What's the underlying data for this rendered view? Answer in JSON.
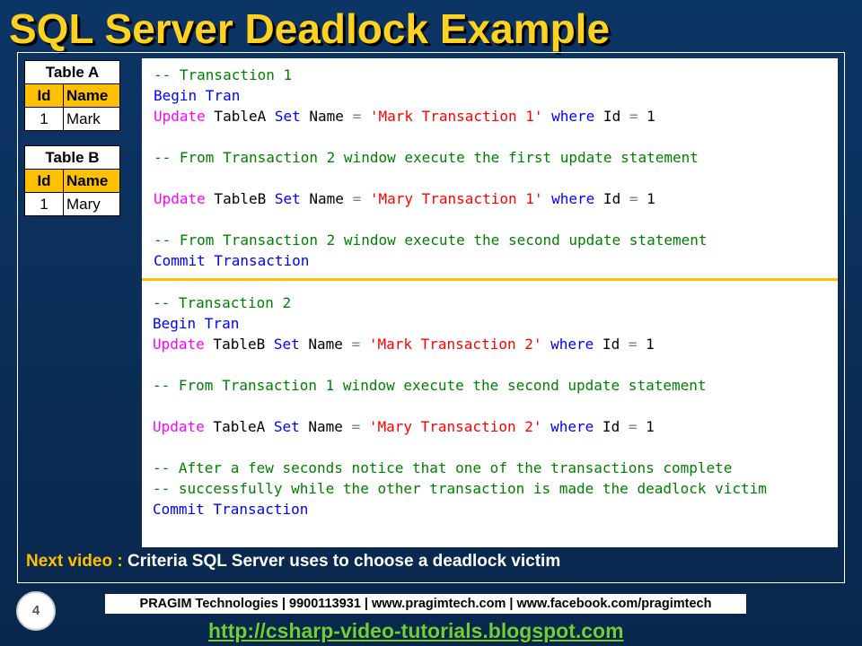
{
  "slide": {
    "title": "SQL Server Deadlock Example",
    "page_number": "4",
    "company_line": "PRAGIM Technologies | 9900113931 | www.pragimtech.com | www.facebook.com/pragimtech",
    "url": "http://csharp-video-tutorials.blogspot.com",
    "next_video_label": "Next video : ",
    "next_video_text": "Criteria SQL Server uses to choose a deadlock victim"
  },
  "tables": [
    {
      "caption": "Table A",
      "headers": [
        "Id",
        "Name"
      ],
      "rows": [
        [
          "1",
          "Mark"
        ]
      ]
    },
    {
      "caption": "Table B",
      "headers": [
        "Id",
        "Name"
      ],
      "rows": [
        [
          "1",
          "Mary"
        ]
      ]
    }
  ],
  "code": {
    "transaction1": {
      "comment_title": "-- Transaction 1",
      "begin": "Begin Tran",
      "update1": {
        "kw_update": "Update",
        "table": " TableA ",
        "kw_set": "Set",
        "col": " Name ",
        "eq": "=",
        "value": " 'Mark Transaction 1' ",
        "kw_where": "where",
        "cond": " Id ",
        "eq2": "=",
        "num": " 1"
      },
      "comment_step": "-- From Transaction 2 window execute the first update statement",
      "update2": {
        "kw_update": "Update",
        "table": " TableB ",
        "kw_set": "Set",
        "col": " Name ",
        "eq": "=",
        "value": " 'Mary Transaction 1' ",
        "kw_where": "where",
        "cond": " Id ",
        "eq2": "=",
        "num": " 1"
      },
      "comment_step2": "-- From Transaction 2 window execute the second update statement",
      "commit": "Commit Transaction"
    },
    "transaction2": {
      "comment_title": "-- Transaction 2",
      "begin": "Begin Tran",
      "update1": {
        "kw_update": "Update",
        "table": " TableB ",
        "kw_set": "Set",
        "col": " Name ",
        "eq": "=",
        "value": " 'Mark Transaction 2' ",
        "kw_where": "where",
        "cond": " Id ",
        "eq2": "=",
        "num": " 1"
      },
      "comment_step": "-- From Transaction 1 window execute the second update statement",
      "update2": {
        "kw_update": "Update",
        "table": " TableA ",
        "kw_set": "Set",
        "col": " Name ",
        "eq": "=",
        "value": " 'Mary Transaction 2' ",
        "kw_where": "where",
        "cond": " Id ",
        "eq2": "=",
        "num": " 1"
      },
      "comment_note1": "-- After a few seconds notice that one of the transactions complete",
      "comment_note2": "-- successfully while the other transaction is made the deadlock victim",
      "commit": "Commit Transaction"
    }
  }
}
